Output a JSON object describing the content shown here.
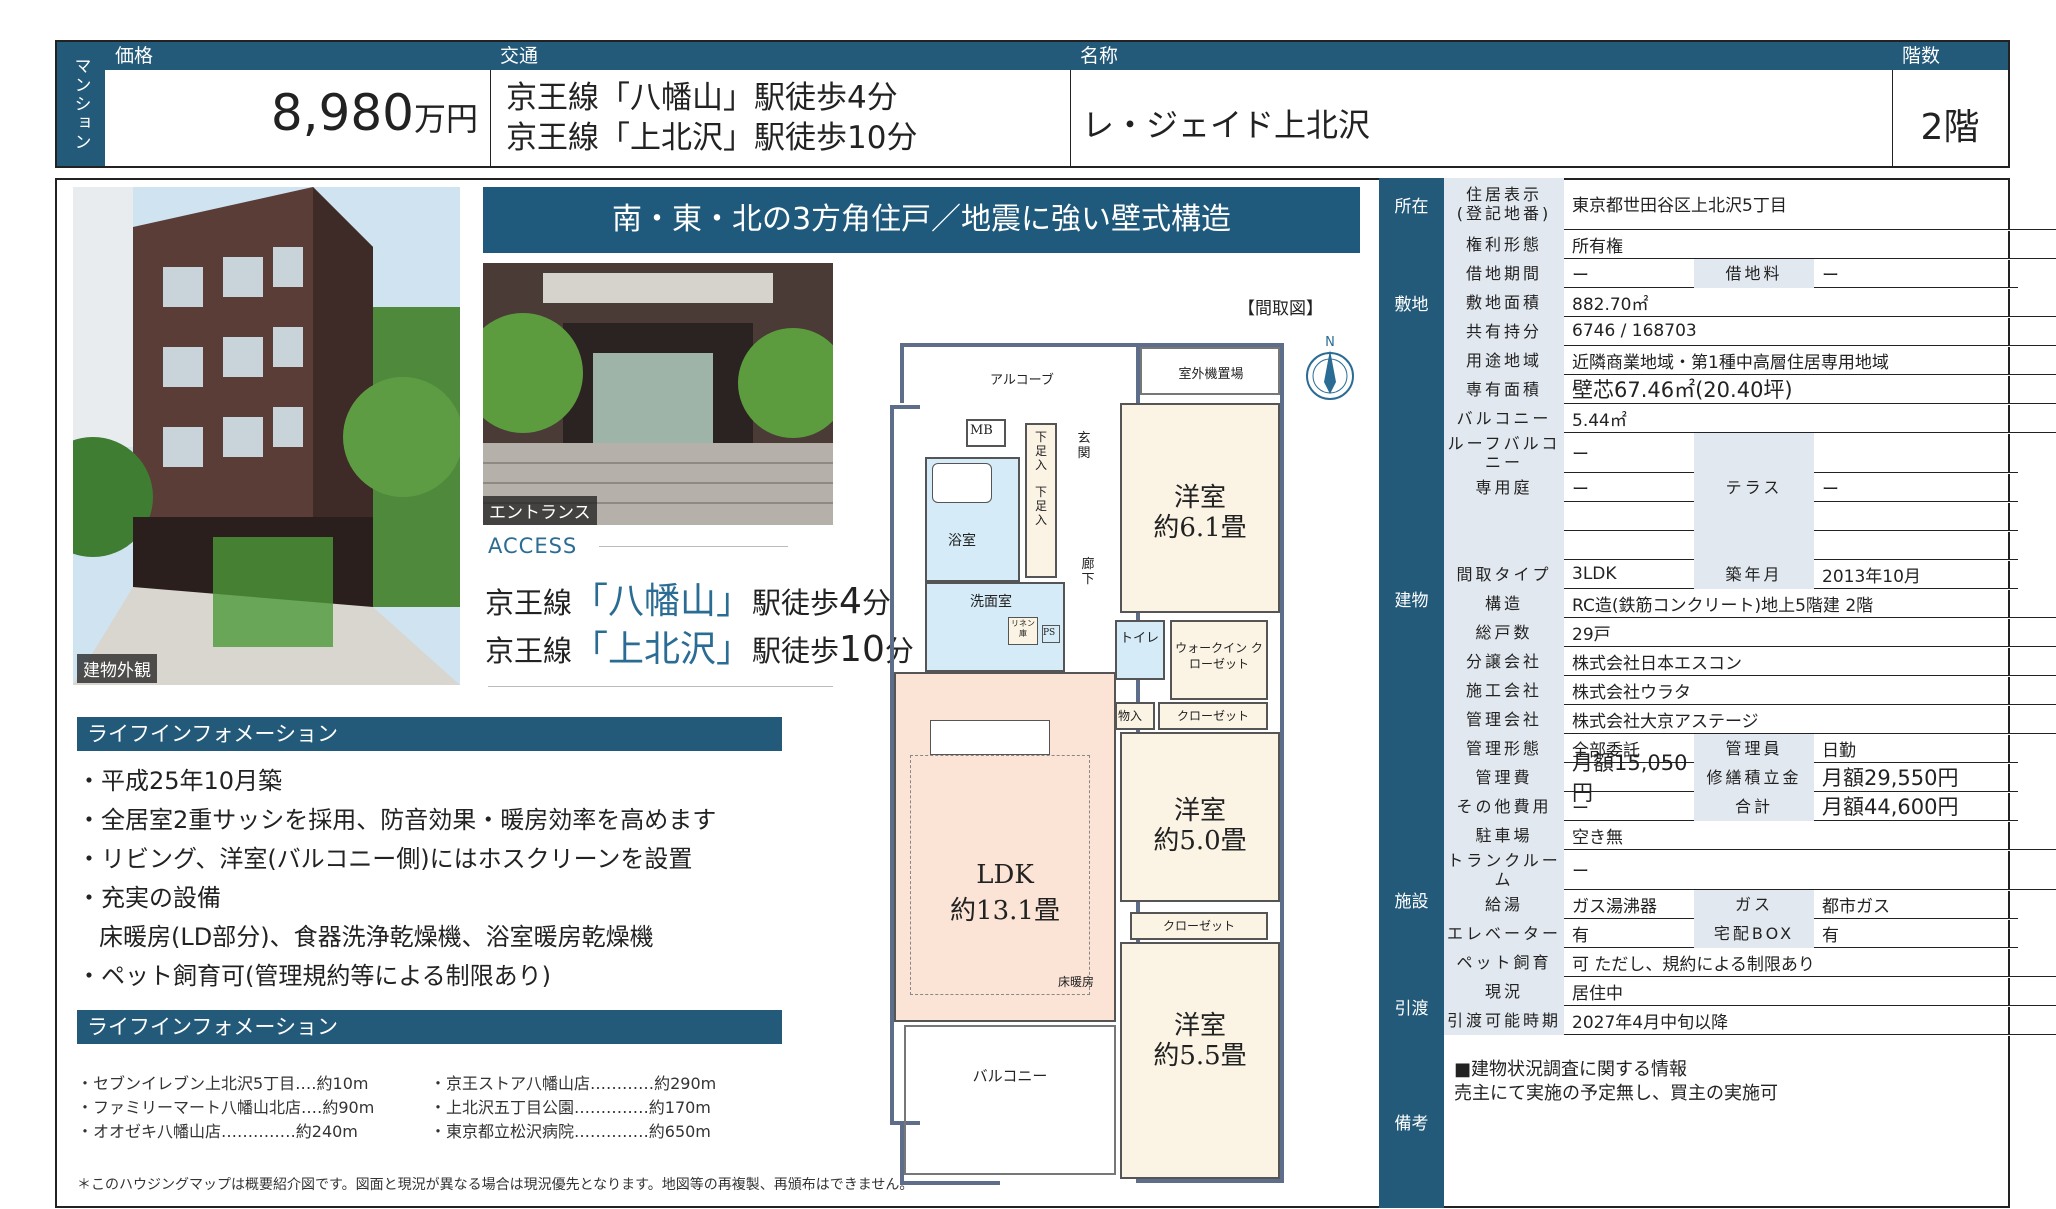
{
  "header": {
    "category": "マンション",
    "price_label": "価格",
    "price_value": "8,980",
    "price_unit": "万円",
    "access_label": "交通",
    "access_line1": "京王線「八幡山」駅徒歩4分",
    "access_line2": "京王線「上北沢」駅徒歩10分",
    "name_label": "名称",
    "name_value": "レ・ジェイド上北沢",
    "floor_label": "階数",
    "floor_value": "2階"
  },
  "photos": {
    "exterior_caption": "建物外観",
    "entrance_caption": "エントランス"
  },
  "headline": "南・東・北の3方角住戸／地震に強い壁式構造",
  "access": {
    "label": "ACCESS",
    "line1_prefix": "京王線",
    "line1_station": "「八幡山」",
    "line1_suffix": "駅徒歩",
    "line1_min": "4",
    "line1_unit": "分",
    "line2_prefix": "京王線",
    "line2_station": "「上北沢」",
    "line2_suffix": "駅徒歩",
    "line2_min": "10",
    "line2_unit": "分"
  },
  "life_info_1": {
    "title": "ライフインフォメーション",
    "items": [
      "・平成25年10月築",
      "・全居室2重サッシを採用、防音効果・暖房効率を高めます",
      "・リビング、洋室(バルコニー側)にはホスクリーンを設置",
      "・充実の設備",
      "床暖房(LD部分)、食器洗浄乾燥機、浴室暖房乾燥機",
      "・ペット飼育可(管理規約等による制限あり)"
    ]
  },
  "life_info_2": {
    "title": "ライフインフォメーション",
    "left": [
      "・セブンイレブン上北沢5丁目‥‥約10m",
      "・ファミリーマート八幡山北店‥‥約90m",
      "・オオゼキ八幡山店‥‥‥‥‥‥‥約240m"
    ],
    "right": [
      "・京王ストア八幡山店‥‥‥‥‥‥約290m",
      "・上北沢五丁目公園‥‥‥‥‥‥‥約170m",
      "・東京都立松沢病院‥‥‥‥‥‥‥約650m"
    ]
  },
  "footnote": "＊このハウジングマップは概要紹介図です。図面と現況が異なる場合は現況優先となります。地図等の再複製、再頒布はできません。",
  "floorplan": {
    "title": "【間取図】",
    "alcove": "アルコーブ",
    "outdoor_unit": "室外機置場",
    "mb": "MB",
    "genkan": "玄関",
    "shoes1": "下足入",
    "shoes2": "下足入",
    "bath": "浴室",
    "hall": "廊下",
    "washroom": "洗面室",
    "linen": "リネン庫",
    "ps": "PS",
    "toilet": "トイレ",
    "wic": "ウォークイン クローゼット",
    "storage": "物入",
    "closet1": "クローゼット",
    "closet2": "クローゼット",
    "room1_name": "洋室",
    "room1_size": "約6.1畳",
    "room2_name": "洋室",
    "room2_size": "約5.0畳",
    "room3_name": "洋室",
    "room3_size": "約5.5畳",
    "ldk_name": "LDK",
    "ldk_size": "約13.1畳",
    "floor_heating": "床暖房",
    "balcony": "バルコニー",
    "north": "N"
  },
  "spec": {
    "cat_location": "所在",
    "cat_land": "敷地",
    "cat_building": "建物",
    "cat_facility": "施設",
    "cat_handover": "引渡",
    "cat_remarks": "備考",
    "address_key": "住居表示\n(登記地番)",
    "address_val": "東京都世田谷区上北沢5丁目",
    "rights_key": "権利形態",
    "rights_val": "所有権",
    "lease_key": "借地期間",
    "lease_val": "ー",
    "rent_key": "借地料",
    "rent_val": "ー",
    "site_area_key": "敷地面積",
    "site_area_val": "882.70㎡",
    "share_key": "共有持分",
    "share_val": "6746 / 168703",
    "zone_key": "用途地域",
    "zone_val": "近隣商業地域・第1種中高層住居専用地域",
    "floor_area_key": "専有面積",
    "floor_area_val": "壁芯67.46㎡(20.40坪)",
    "balcony_key": "バルコニー",
    "balcony_val": "5.44㎡",
    "roof_key": "ルーフバルコニー",
    "roof_val": "ー",
    "terrace_key": "テラス",
    "terrace_val": "ー",
    "garden_key": "専用庭",
    "garden_val": "ー",
    "layout_key": "間取タイプ",
    "layout_val": "3LDK",
    "built_key": "築年月",
    "built_val": "2013年10月",
    "structure_key": "構造",
    "structure_val": "RC造(鉄筋コンクリート)地上5階建 2階",
    "units_key": "総戸数",
    "units_val": "29戸",
    "seller_key": "分譲会社",
    "seller_val": "株式会社日本エスコン",
    "builder_key": "施工会社",
    "builder_val": "株式会社ウラタ",
    "mgmt_co_key": "管理会社",
    "mgmt_co_val": "株式会社大京アステージ",
    "mgmt_type_key": "管理形態",
    "mgmt_type_val": "全部委託",
    "manager_key": "管理員",
    "manager_val": "日勤",
    "mgmt_fee_key": "管理費",
    "mgmt_fee_val": "月額15,050円",
    "repair_key": "修繕積立金",
    "repair_val": "月額29,550円",
    "other_fee_key": "その他費用",
    "other_fee_val": "ー",
    "total_key": "合計",
    "total_val": "月額44,600円",
    "parking_key": "駐車場",
    "parking_val": "空き無",
    "trunk_key": "トランクルーム",
    "trunk_val": "ー",
    "water_key": "給湯",
    "water_val": "ガス湯沸器",
    "gas_key": "ガス",
    "gas_val": "都市ガス",
    "elevator_key": "エレベーター",
    "elevator_val": "有",
    "delivery_key": "宅配BOX",
    "delivery_val": "有",
    "pet_key": "ペット飼育",
    "pet_val": "可 ただし、規約による制限あり",
    "status_key": "現況",
    "status_val": "居住中",
    "handover_key": "引渡可能時期",
    "handover_val": "2027年4月中旬以降",
    "remarks_line1": "■建物状況調査に関する情報",
    "remarks_line2": "売主にて実施の予定無し、買主の実施可"
  }
}
